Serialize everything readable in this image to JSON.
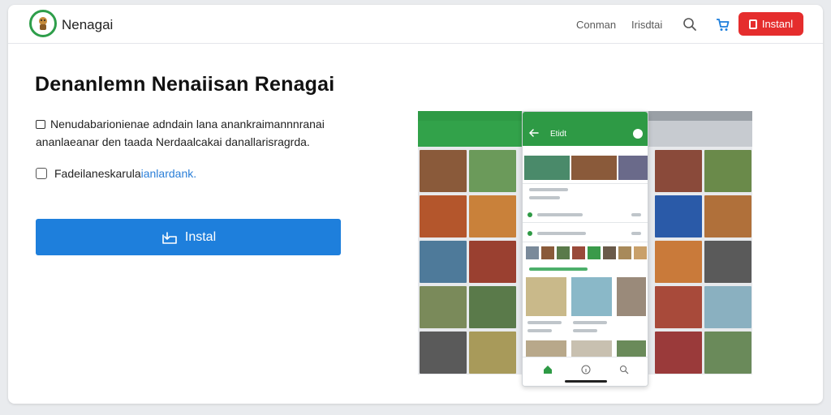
{
  "header": {
    "brand": "Nenagai",
    "nav": [
      "Conman",
      "Irisdtai"
    ],
    "install_label": "Instanl"
  },
  "hero": {
    "title": "Denanlemn Nenaiisan Renagai",
    "description_line1": "Nenudabarionienae adndain lana anankraimannnranai",
    "description_line2": "ananlaeanar den taada Nerdaalcakai danallarisragrda.",
    "checkbox_text": "Fadeilaneskarula",
    "checkbox_link": "ianlardank.",
    "install_button": "Instal"
  },
  "phone": {
    "title": "Etidt"
  },
  "icons": {
    "logo": "mascot-logo-icon",
    "search": "search-icon",
    "cart": "cart-icon",
    "install": "install-icon",
    "back": "back-arrow-icon",
    "home": "home-icon",
    "info": "info-icon",
    "phone_search": "search-icon"
  },
  "colors": {
    "brand_green": "#2e9a45",
    "install_red": "#e52d2d",
    "install_blue": "#1e7fdc",
    "link_blue": "#2b7fd8"
  }
}
